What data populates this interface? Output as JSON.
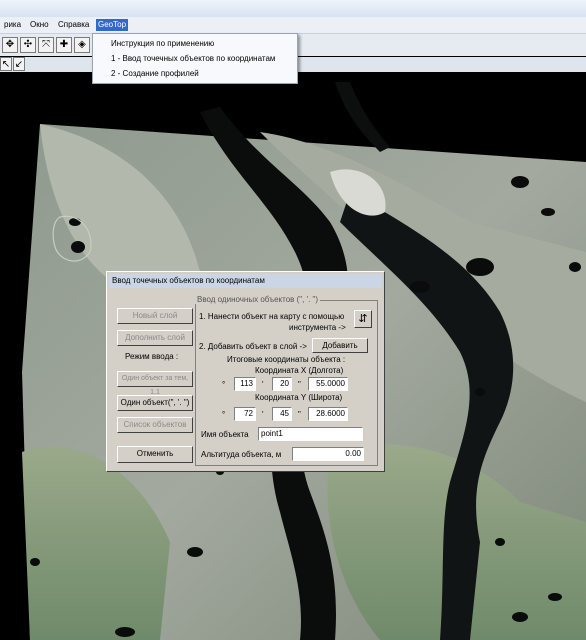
{
  "menu": {
    "items": [
      {
        "label": "рика"
      },
      {
        "label": "Окно"
      },
      {
        "label": "Справка"
      },
      {
        "label": "GeoTop"
      }
    ],
    "dropdown": [
      "Инструкция по применению",
      "1 - Ввод точечных объектов по координатам",
      "2 - Создание профилей"
    ]
  },
  "dialog": {
    "title": "Ввод точечных объектов по координатам",
    "buttons": {
      "new_layer": "Новый слой",
      "save_layer": "Дополнить слой",
      "mode_label": "Режим ввода :",
      "one_by_one": "Один объект за тем, 1,1",
      "one_object": "Один объект(\", '. \")",
      "list_objects": "Список объектов",
      "cancel": "Отменить"
    },
    "group_title": "Ввод одиночных объектов (\", '. \")",
    "step1": "1. Нанести объект на карту с помощью",
    "step1b": "инструмента ->",
    "step2": "2. Добавить объект в слой ->",
    "add_button": "Добавить",
    "result_label": "Итоговые координаты объекта :",
    "x_label": "Координата X (Долгота)",
    "y_label": "Координата Y (Широта)",
    "x": {
      "deg": "113",
      "min": "20",
      "sec": "55.0000"
    },
    "y": {
      "deg": "72",
      "min": "45",
      "sec": "28.6000"
    },
    "name_label": "Имя объекта",
    "name_value": "point1",
    "alt_label": "Альтитуда объекта, м",
    "alt_value": "0.00",
    "deg_sym": "°",
    "min_sym": "'",
    "sec_sym": "\""
  }
}
